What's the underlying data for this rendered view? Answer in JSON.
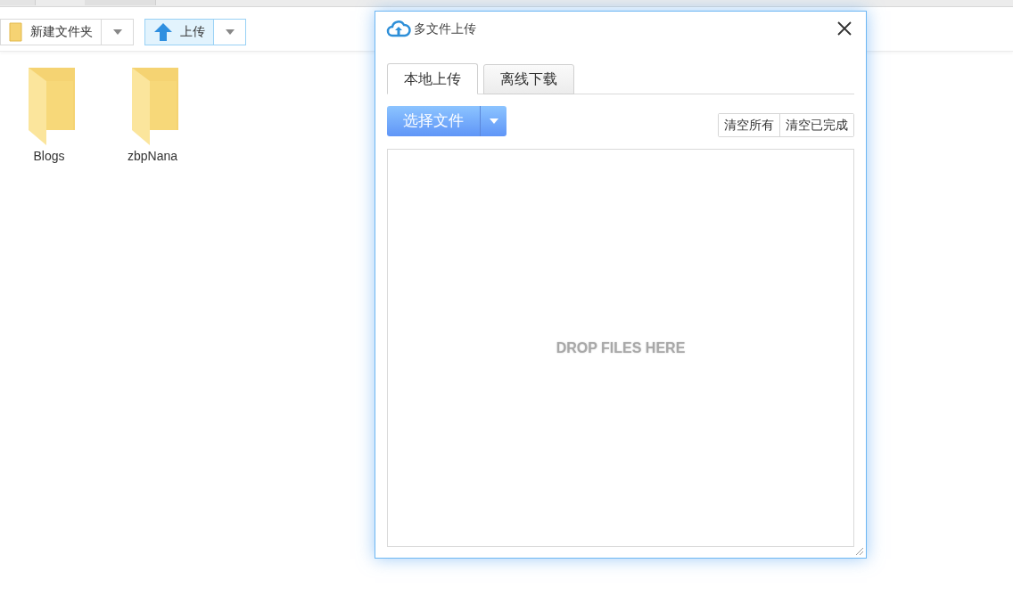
{
  "toolbar": {
    "buttons": [
      {
        "kind": "folder",
        "label": "新建文件夹",
        "highlighted": false
      },
      {
        "kind": "upload",
        "label": "上传",
        "highlighted": true
      }
    ]
  },
  "files": [
    {
      "name": "Blogs"
    },
    {
      "name": "zbpNana"
    }
  ],
  "dialog": {
    "title": "多文件上传",
    "tabs": [
      {
        "label": "本地上传",
        "selected": true
      },
      {
        "label": "离线下载",
        "selected": false
      }
    ],
    "choose_button": "选择文件",
    "actions": [
      "清空所有",
      "清空已完成"
    ],
    "drop_hint": "DROP FILES HERE"
  }
}
